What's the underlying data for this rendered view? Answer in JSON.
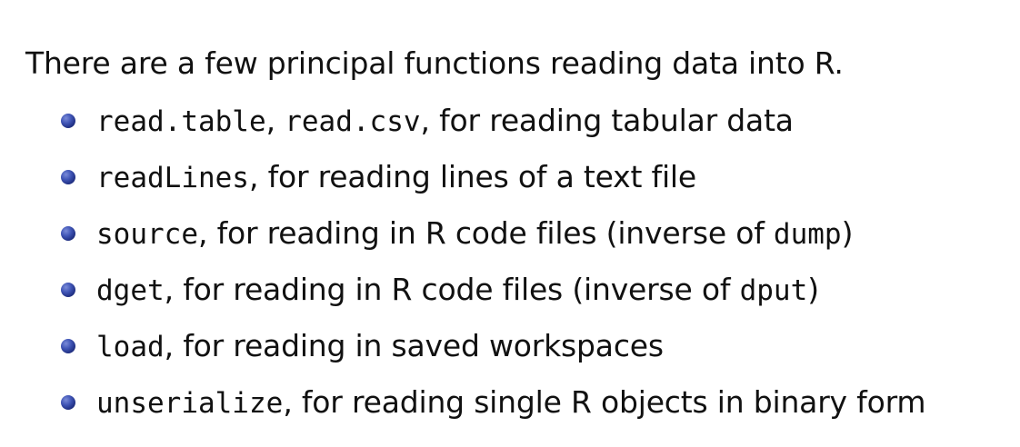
{
  "intro": "There are a few principal functions reading data into R.",
  "bullets": [
    {
      "parts": [
        {
          "text": "read.table",
          "code": true
        },
        {
          "text": ", ",
          "code": false
        },
        {
          "text": "read.csv",
          "code": true
        },
        {
          "text": ", for reading tabular data",
          "code": false
        }
      ]
    },
    {
      "parts": [
        {
          "text": "readLines",
          "code": true
        },
        {
          "text": ", for reading lines of a text file",
          "code": false
        }
      ]
    },
    {
      "parts": [
        {
          "text": "source",
          "code": true
        },
        {
          "text": ", for reading in R code files (inverse of ",
          "code": false
        },
        {
          "text": "dump",
          "code": true
        },
        {
          "text": ")",
          "code": false
        }
      ]
    },
    {
      "parts": [
        {
          "text": "dget",
          "code": true
        },
        {
          "text": ", for reading in R code files (inverse of ",
          "code": false
        },
        {
          "text": "dput",
          "code": true
        },
        {
          "text": ")",
          "code": false
        }
      ]
    },
    {
      "parts": [
        {
          "text": "load",
          "code": true
        },
        {
          "text": ", for reading in saved workspaces",
          "code": false
        }
      ]
    },
    {
      "parts": [
        {
          "text": "unserialize",
          "code": true
        },
        {
          "text": ", for reading single R objects in binary form",
          "code": false
        }
      ]
    }
  ],
  "bullet_color": "#2a3a99"
}
